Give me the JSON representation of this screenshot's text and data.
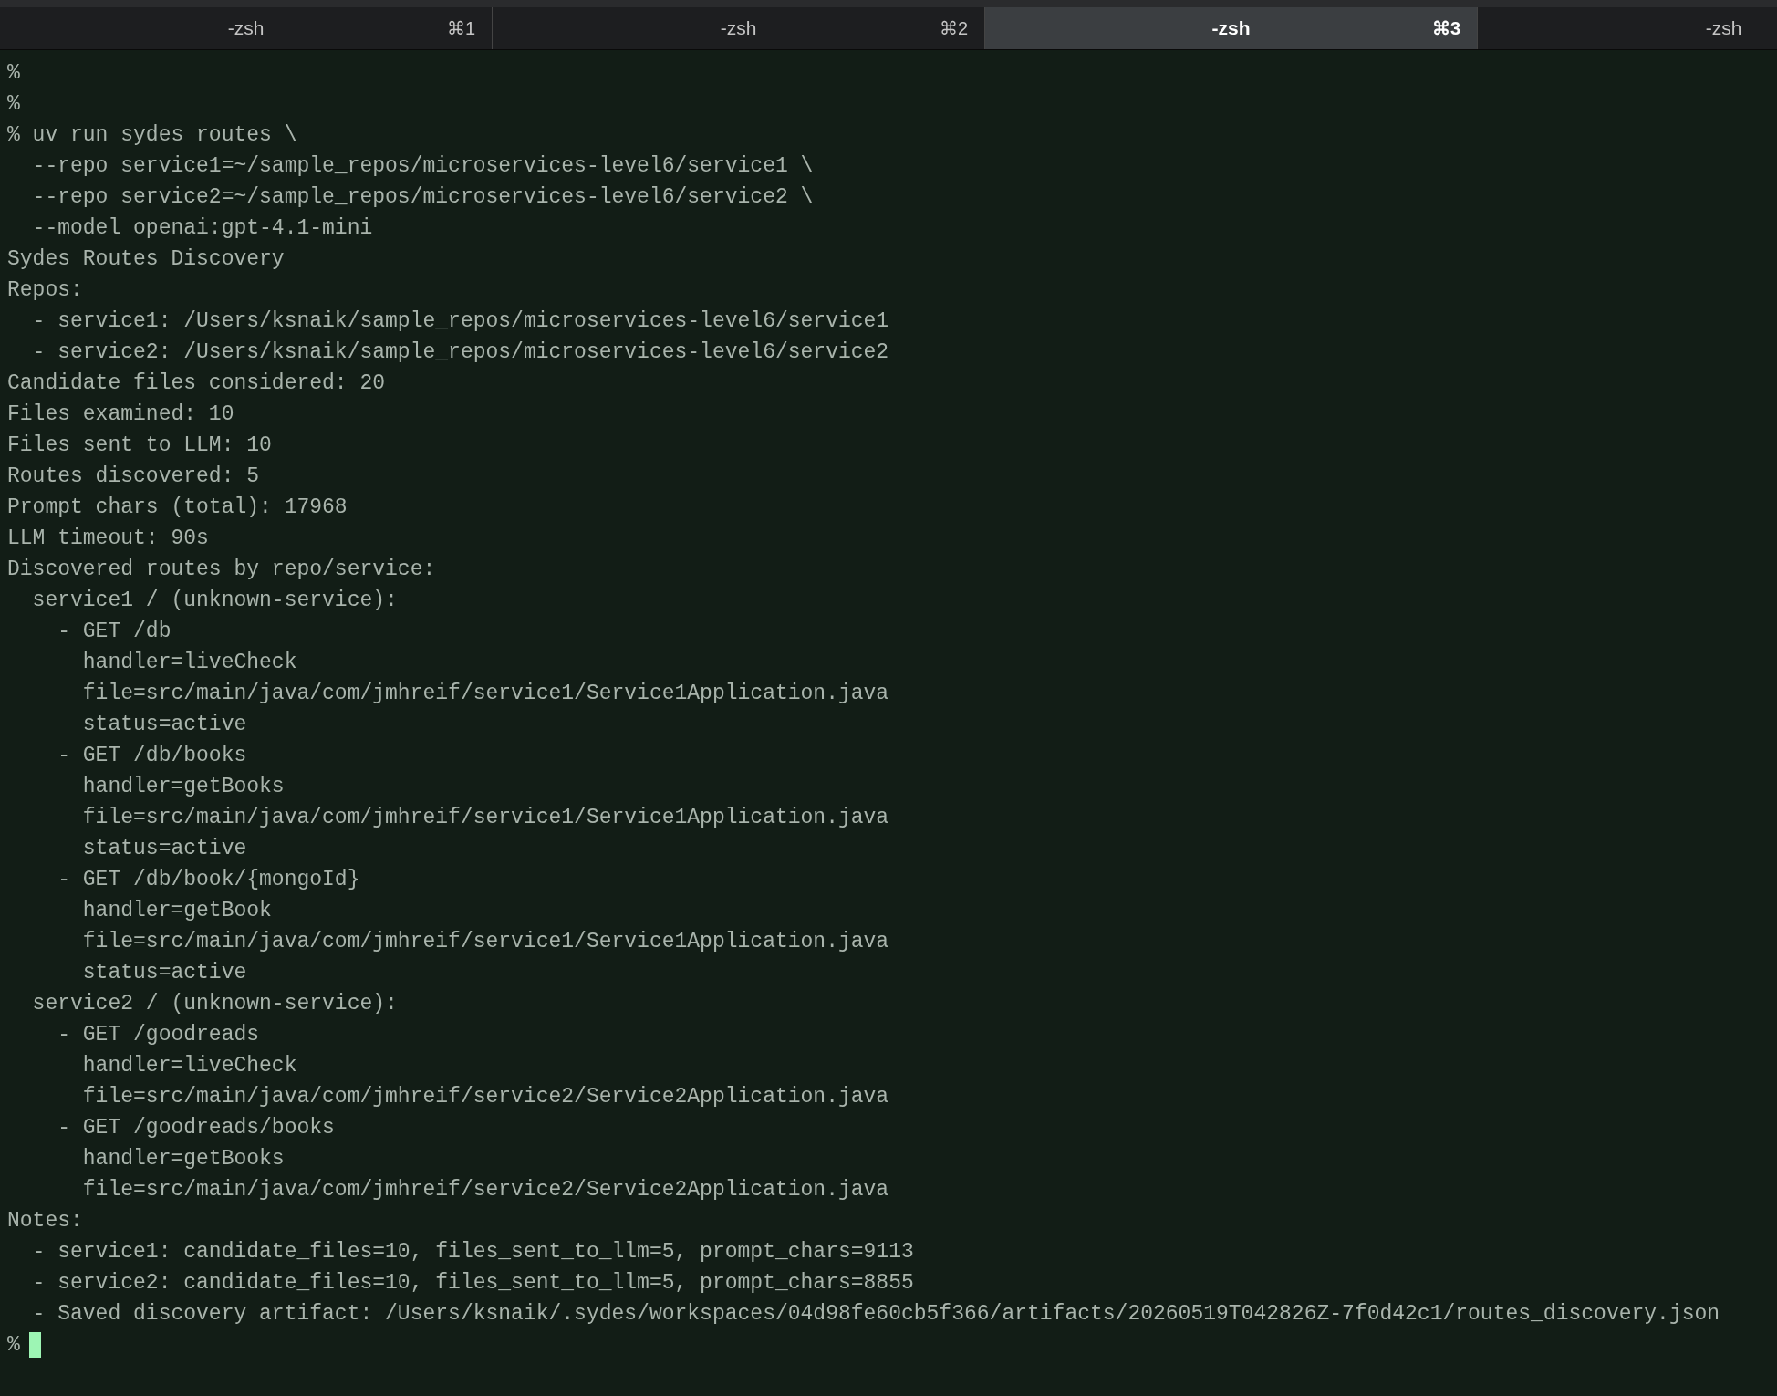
{
  "tabs": [
    {
      "title": "-zsh",
      "shortcut": "⌘1",
      "selected": false
    },
    {
      "title": "-zsh",
      "shortcut": "⌘2",
      "selected": false
    },
    {
      "title": "-zsh",
      "shortcut": "⌘3",
      "selected": true
    },
    {
      "title": "-zsh",
      "selected": false
    }
  ],
  "lines": [
    "%",
    "%",
    "% uv run sydes routes \\",
    "  --repo service1=~/sample_repos/microservices-level6/service1 \\",
    "  --repo service2=~/sample_repos/microservices-level6/service2 \\",
    "  --model openai:gpt-4.1-mini",
    "Sydes Routes Discovery",
    "Repos:",
    "  - service1: /Users/ksnaik/sample_repos/microservices-level6/service1",
    "  - service2: /Users/ksnaik/sample_repos/microservices-level6/service2",
    "Candidate files considered: 20",
    "Files examined: 10",
    "Files sent to LLM: 10",
    "Routes discovered: 5",
    "Prompt chars (total): 17968",
    "LLM timeout: 90s",
    "Discovered routes by repo/service:",
    "  service1 / (unknown-service):",
    "    - GET /db",
    "      handler=liveCheck",
    "      file=src/main/java/com/jmhreif/service1/Service1Application.java",
    "      status=active",
    "    - GET /db/books",
    "      handler=getBooks",
    "      file=src/main/java/com/jmhreif/service1/Service1Application.java",
    "      status=active",
    "    - GET /db/book/{mongoId}",
    "      handler=getBook",
    "      file=src/main/java/com/jmhreif/service1/Service1Application.java",
    "      status=active",
    "  service2 / (unknown-service):",
    "    - GET /goodreads",
    "      handler=liveCheck",
    "      file=src/main/java/com/jmhreif/service2/Service2Application.java",
    "    - GET /goodreads/books",
    "      handler=getBooks",
    "      file=src/main/java/com/jmhreif/service2/Service2Application.java",
    "Notes:",
    "  - service1: candidate_files=10, files_sent_to_llm=5, prompt_chars=9113",
    "  - service2: candidate_files=10, files_sent_to_llm=5, prompt_chars=8855",
    "  - Saved discovery artifact: /Users/ksnaik/.sydes/workspaces/04d98fe60cb5f366/artifacts/20260519T042826Z-7f0d42c1/routes_discovery.json"
  ],
  "prompt": {
    "text": "%",
    "cursor": true
  }
}
